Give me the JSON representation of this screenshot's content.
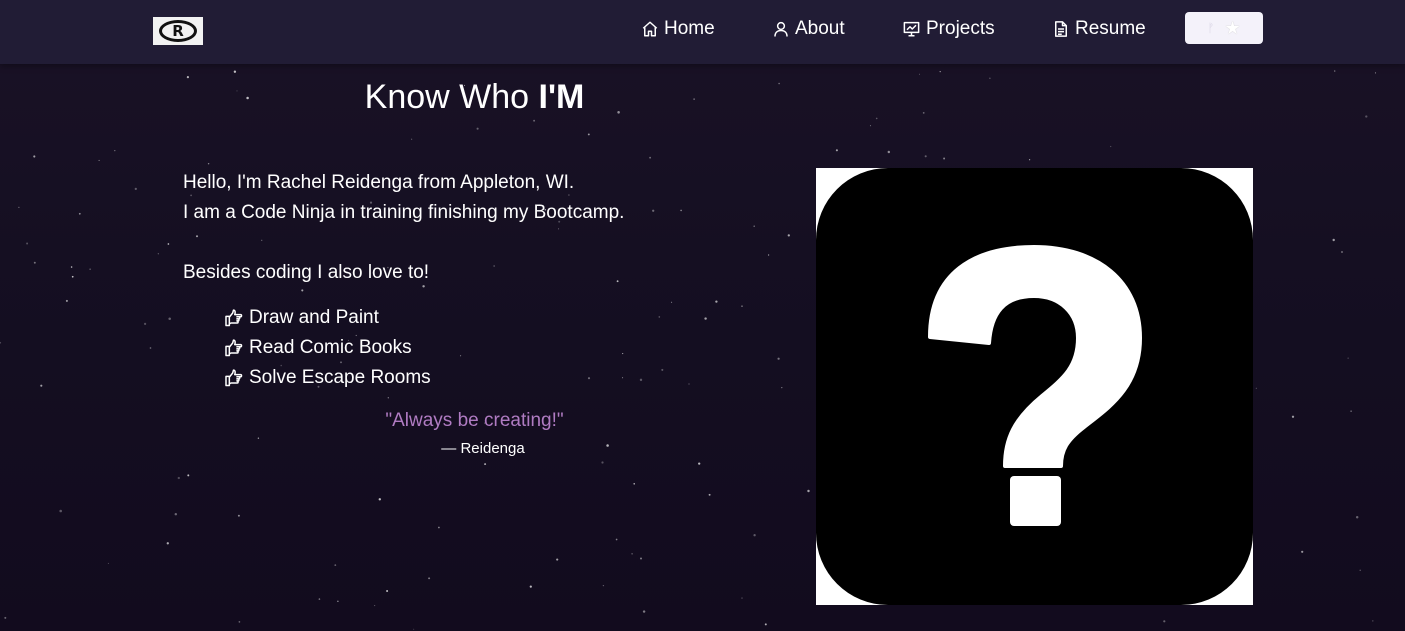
{
  "nav": {
    "logo_text": "R",
    "items": [
      {
        "label": "Home",
        "icon": "home-icon"
      },
      {
        "label": "About",
        "icon": "user-icon"
      },
      {
        "label": "Projects",
        "icon": "presentation-icon"
      },
      {
        "label": "Resume",
        "icon": "document-icon"
      }
    ],
    "star_button": {
      "fork_icon": "fork-icon",
      "star_icon": "star-icon"
    }
  },
  "about": {
    "heading_prefix": "Know Who ",
    "heading_strong": "I'M",
    "intro_line1": "Hello, I'm Rachel Reidenga from Appleton, WI.",
    "intro_line2": "I am a Code Ninja in training finishing my Bootcamp.",
    "hobbies_intro": "Besides coding I also love to!",
    "hobbies": [
      {
        "label": "Draw and Paint",
        "icon": "pointing-hand-icon"
      },
      {
        "label": "Read Comic Books",
        "icon": "pointing-hand-icon"
      },
      {
        "label": "Solve Escape Rooms",
        "icon": "pointing-hand-icon"
      }
    ],
    "quote": "\"Always be creating!\"",
    "quote_author": "— Reidenga"
  },
  "avatar": {
    "icon": "question-mark-icon"
  },
  "colors": {
    "background": "#150f22",
    "navbar": "#211c35",
    "quote": "#b07bc2",
    "text": "#ffffff"
  }
}
